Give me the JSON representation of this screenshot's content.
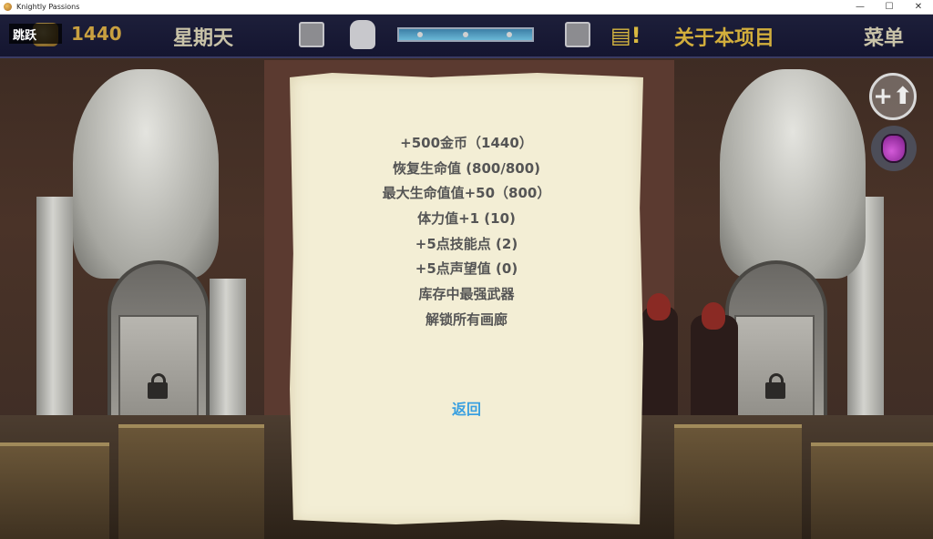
{
  "window": {
    "title": "Knightly Passions",
    "controls": [
      "—",
      "☐",
      "✕"
    ]
  },
  "hud": {
    "skip_label": "跳跃",
    "gold_amount": "1440",
    "day_label": "星期天",
    "about_label": "关于本项目",
    "menu_label": "菜单",
    "quest_icon_glyph": "▤!",
    "levelup_glyph": "+⬆"
  },
  "dialog": {
    "rewards": [
      "+500金币（1440）",
      "恢复生命值 (800/800)",
      "最大生命值值+50（800）",
      "体力值+1 (10)",
      "+5点技能点 (2)",
      "+5点声望值 (0)",
      "库存中最强武器",
      "解锁所有画廊"
    ],
    "back_label": "返回"
  },
  "colors": {
    "parchment": "#f3eed5",
    "reward_text": "#555555",
    "back_link": "#3aa0e0",
    "hud_gold": "#d2ae3c"
  },
  "icons": [
    "app-icon",
    "gold-coin-icon",
    "map-icon",
    "backpack-icon",
    "time-of-day-bar",
    "inventory-icon",
    "quest-log-icon",
    "level-up-icon",
    "potion-icon",
    "lock-icon"
  ]
}
